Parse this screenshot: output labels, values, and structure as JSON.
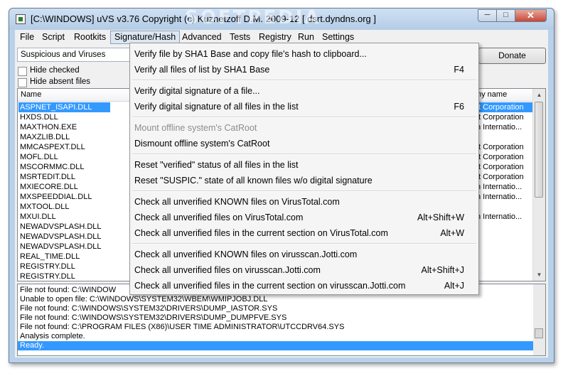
{
  "window": {
    "title": "[C:\\WINDOWS] uVS v3.76 Copyright (c) Kuznetzoff D.M. 2009-12 [ dsrt.dyndns.org ]",
    "buttons": {
      "minimize": "─",
      "maximize": "□",
      "close": "✕"
    }
  },
  "menubar": [
    "File",
    "Script",
    "Rootkits",
    "Signature/Hash",
    "Advanced",
    "Tests",
    "Registry",
    "Run",
    "Settings"
  ],
  "toolbar": {
    "filter_combo": "Suspicious and Viruses",
    "hide_checked": "Hide checked",
    "hide_absent": "Hide absent files",
    "donate": "Donate"
  },
  "list": {
    "col_name": "Name",
    "col_company": "ny name",
    "rows": [
      {
        "name": "ASPNET_ISAPI.DLL",
        "company": "ft Corporation"
      },
      {
        "name": "HXDS.DLL",
        "company": "ft Corporation"
      },
      {
        "name": "MAXTHON.EXE",
        "company": "n Internatio..."
      },
      {
        "name": "MAXZLIB.DLL",
        "company": ""
      },
      {
        "name": "MMCASPEXT.DLL",
        "company": "ft Corporation"
      },
      {
        "name": "MOFL.DLL",
        "company": "ft Corporation"
      },
      {
        "name": "MSCORMMC.DLL",
        "company": "ft Corporation"
      },
      {
        "name": "MSRTEDIT.DLL",
        "company": "ft Corporation"
      },
      {
        "name": "MXIECORE.DLL",
        "company": "n Internatio..."
      },
      {
        "name": "MXSPEEDDIAL.DLL",
        "company": "n Internatio..."
      },
      {
        "name": "MXTOOL.DLL",
        "company": ""
      },
      {
        "name": "MXUI.DLL",
        "company": "n Internatio..."
      },
      {
        "name": "NEWADVSPLASH.DLL",
        "company": ""
      },
      {
        "name": "NEWADVSPLASH.DLL",
        "company": ""
      },
      {
        "name": "NEWADVSPLASH.DLL",
        "company": ""
      },
      {
        "name": "REAL_TIME.DLL",
        "company": ""
      },
      {
        "name": "REGISTRY.DLL",
        "company": ""
      },
      {
        "name": "REGISTRY.DLL",
        "company": ""
      }
    ]
  },
  "log": [
    "File not found: C:\\WINDOW",
    "Unable to open file: C:\\WINDOWS\\SYSTEM32\\WBEM\\WMIPJOBJ.DLL",
    "File not found: C:\\WINDOWS\\SYSTEM32\\DRIVERS\\DUMP_IASTOR.SYS",
    "File not found: C:\\WINDOWS\\SYSTEM32\\DRIVERS\\DUMP_DUMPFVE.SYS",
    "File not found: C:\\PROGRAM FILES (X86)\\USER TIME ADMINISTRATOR\\UTCCDRV64.SYS",
    "Analysis complete.",
    "Ready."
  ],
  "signature_menu": [
    {
      "label": "Verify file by SHA1 Base and copy file's hash to clipboard...",
      "key": ""
    },
    {
      "label": "Verify all files of list by SHA1 Base",
      "key": "F4"
    },
    {
      "label": "Verify digital signature of a file...",
      "key": ""
    },
    {
      "label": "Verify digital signature of all files in the list",
      "key": "F6"
    },
    {
      "label": "Mount offline system's CatRoot",
      "key": ""
    },
    {
      "label": "Dismount offline system's CatRoot",
      "key": ""
    },
    {
      "label": "Reset \"verified\" status of all files in the list",
      "key": ""
    },
    {
      "label": "Reset \"SUSPIC.\" state of all known files w/o digital signature",
      "key": ""
    },
    {
      "label": "Check all unverified KNOWN files on VirusTotal.com",
      "key": ""
    },
    {
      "label": "Check all unverified files on VirusTotal.com",
      "key": "Alt+Shift+W"
    },
    {
      "label": "Check all unverified files in the current section on VirusTotal.com",
      "key": "Alt+W"
    },
    {
      "label": "Check all unverified KNOWN files on virusscan.Jotti.com",
      "key": ""
    },
    {
      "label": "Check all unverified files on virusscan.Jotti.com",
      "key": "Alt+Shift+J"
    },
    {
      "label": "Check all unverified files in the current section on virusscan.Jotti.com",
      "key": "Alt+J"
    }
  ],
  "watermark": "SOFTPEDIA"
}
